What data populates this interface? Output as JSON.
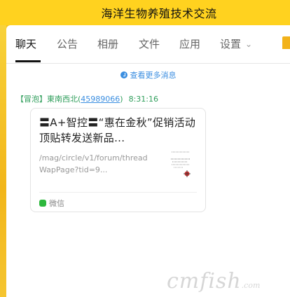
{
  "window": {
    "title": "海洋生物养殖技术交流"
  },
  "tabs": [
    {
      "label": "聊天",
      "active": true
    },
    {
      "label": "公告"
    },
    {
      "label": "相册"
    },
    {
      "label": "文件"
    },
    {
      "label": "应用"
    },
    {
      "label": "设置"
    }
  ],
  "chat": {
    "load_more": "查看更多消息",
    "message": {
      "tag": "【冒泡】",
      "sender": "東南西北",
      "qq": "45989066",
      "time": "8:31:16",
      "card": {
        "title": "〓A+智控〓“惠在金秋”促销活动顶贴转发送新品...",
        "url": "/mag/circle/v1/forum/threadWapPage?tid=9...",
        "source": "微信"
      }
    }
  },
  "watermark": {
    "text": "cmfish",
    "suffix": ".com"
  },
  "colors": {
    "accent": "#ffd21f",
    "link": "#3b8ee0",
    "sender": "#2f9e5b",
    "wechat": "#2db83d"
  },
  "icons": {
    "load_more": "clock-icon",
    "source": "wechat-icon",
    "settings": "chevron-down-icon"
  }
}
